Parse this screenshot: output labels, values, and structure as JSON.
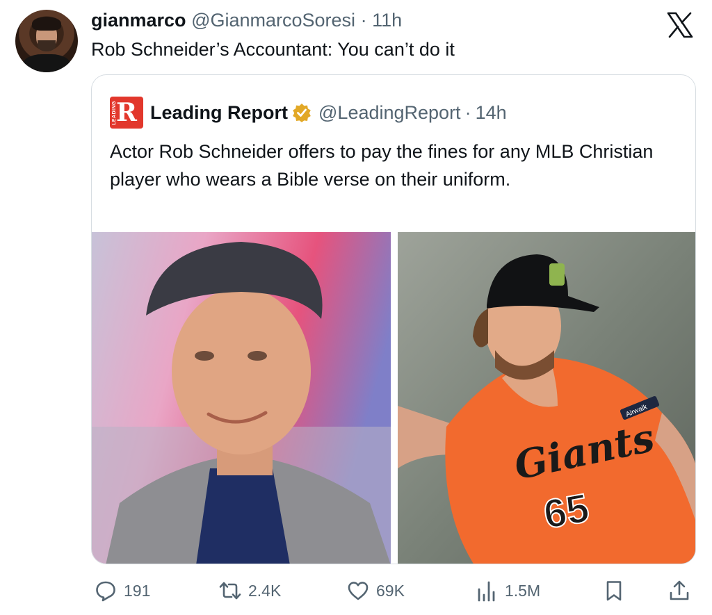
{
  "tweet": {
    "author_name": "gianmarco",
    "author_handle": "@GianmarcoSoresi",
    "separator": "·",
    "time": "11h",
    "text": "Rob Schneider’s Accountant: You can’t do it"
  },
  "platform_logo": "x-logo-icon",
  "quoted": {
    "logo_letter": "R",
    "logo_side_text": "LEADING",
    "name": "Leading Report",
    "verified_icon": "gold-verified-badge-icon",
    "handle": "@LeadingReport",
    "separator": "·",
    "time": "14h",
    "text": "Actor Rob Schneider offers to pay the fines for any MLB Christian player who wears a Bible verse on their uniform.",
    "jersey_wordmark": "Giants",
    "jersey_number": "65",
    "sleeve_patch": "Airwalk"
  },
  "actions": {
    "replies": "191",
    "reposts": "2.4K",
    "likes": "69K",
    "views": "1.5M"
  },
  "colors": {
    "verified_gold": "#e2a826",
    "logo_red": "#e2372c",
    "muted_text": "#536471",
    "jersey_orange": "#f26a2e"
  }
}
